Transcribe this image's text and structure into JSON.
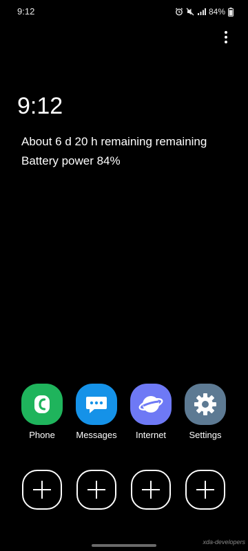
{
  "status_bar": {
    "time": "9:12",
    "battery_percent": "84%",
    "icons": [
      "alarm-icon",
      "mute-icon",
      "signal-icon",
      "battery-icon"
    ]
  },
  "menu": {
    "icon": "more-vertical-icon"
  },
  "clock": "9:12",
  "battery": {
    "remaining_text": "About 6 d 20 h remaining remaining",
    "power_text": "Battery power 84%"
  },
  "apps": [
    {
      "label": "Phone",
      "icon": "phone-icon",
      "color": "#1fb45c"
    },
    {
      "label": "Messages",
      "icon": "messages-icon",
      "color": "#1592e8"
    },
    {
      "label": "Internet",
      "icon": "internet-icon",
      "color": "#6e79f5"
    },
    {
      "label": "Settings",
      "icon": "settings-icon",
      "color": "#5d7a93"
    }
  ],
  "add_slots": {
    "count": 4,
    "icon": "plus-icon"
  },
  "watermark": "xda-developers"
}
